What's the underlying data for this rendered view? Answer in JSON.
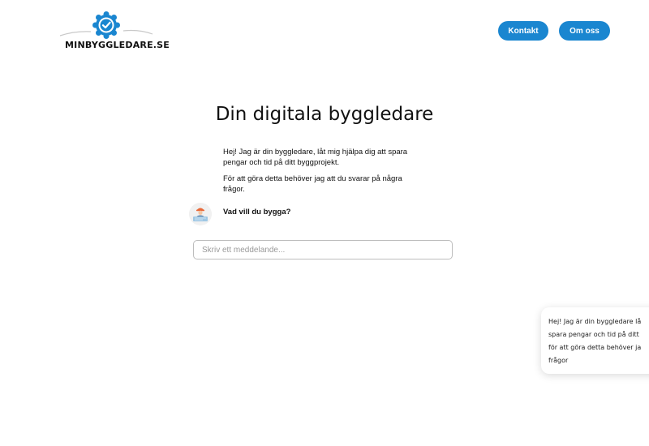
{
  "header": {
    "logo_text": "MINBYGGLEDARE.SE",
    "nav": [
      {
        "label": "Kontakt"
      },
      {
        "label": "Om oss"
      }
    ]
  },
  "main": {
    "title": "Din digitala byggledare",
    "messages": [
      {
        "text": "Hej! Jag är din byggledare, låt mig hjälpa dig att spara pengar och tid på ditt byggprojekt."
      },
      {
        "text": "För att göra detta behöver jag att du svarar på några frågor."
      }
    ],
    "question": "Vad vill du bygga?",
    "input": {
      "placeholder": "Skriv ett meddelande..."
    }
  },
  "popup": {
    "lines": [
      "Hej! Jag är din byggledare lå",
      "spara pengar och tid på ditt",
      "för att göra detta behöver ja",
      "frågor"
    ]
  },
  "colors": {
    "accent": "#1a86d0",
    "text": "#111111",
    "border": "#bdbdbd"
  }
}
